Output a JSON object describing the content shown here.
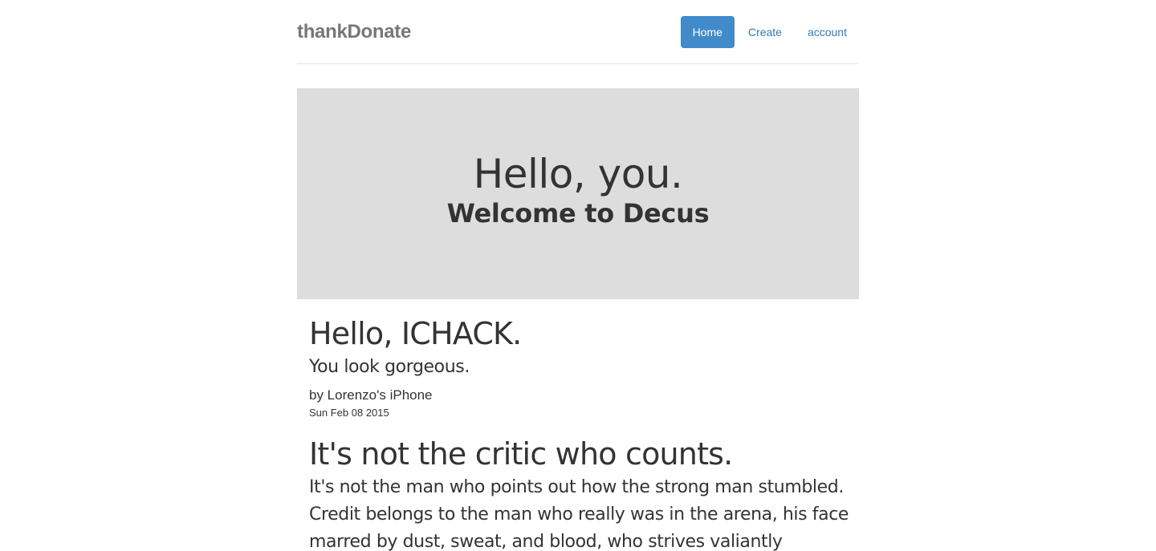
{
  "header": {
    "brand": "thankDonate",
    "nav": [
      {
        "label": "Home",
        "active": true
      },
      {
        "label": "Create",
        "active": false
      },
      {
        "label": "account",
        "active": false
      }
    ]
  },
  "jumbotron": {
    "title": "Hello, you.",
    "subtitle": "Welcome to Decus"
  },
  "posts": [
    {
      "title": "Hello, ICHACK.",
      "body": "You look gorgeous.",
      "author": "by Lorenzo's iPhone",
      "date": "Sun Feb 08 2015"
    },
    {
      "title": "It's not the critic who counts.",
      "body": "It's not the man who points out how the strong man stumbled. Credit belongs to the man who really was in the arena, his face marred by dust, sweat, and blood, who strives valiantly"
    }
  ],
  "colors": {
    "accent": "#428bca",
    "link": "#337ab7",
    "jumbotron_bg": "#dddddd",
    "brand": "#777777"
  }
}
